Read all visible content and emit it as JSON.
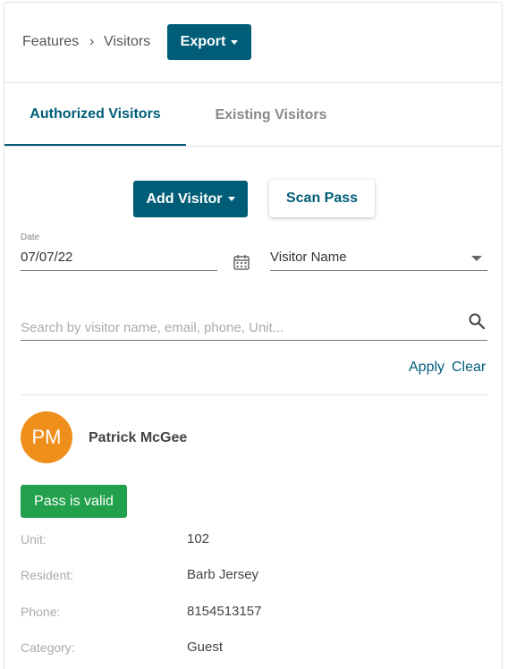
{
  "breadcrumb": {
    "features": "Features",
    "separator": "›",
    "visitors": "Visitors"
  },
  "toolbar": {
    "export_label": "Export"
  },
  "tabs": [
    {
      "label": "Authorized Visitors",
      "active": true
    },
    {
      "label": "Existing Visitors",
      "active": false
    }
  ],
  "actions": {
    "add_visitor_label": "Add Visitor",
    "scan_pass_label": "Scan Pass"
  },
  "filters": {
    "date_label": "Date",
    "date_value": "07/07/22",
    "select_value": "Visitor Name",
    "search_placeholder": "Search by visitor name, email, phone, Unit...",
    "apply_label": "Apply",
    "clear_label": "Clear"
  },
  "visitor": {
    "initials": "PM",
    "name": "Patrick McGee",
    "pass_status": "Pass is valid",
    "details": [
      {
        "label": "Unit:",
        "value": "102"
      },
      {
        "label": "Resident:",
        "value": "Barb Jersey"
      },
      {
        "label": "Phone:",
        "value": "8154513157"
      },
      {
        "label": "Category:",
        "value": "Guest"
      }
    ]
  },
  "colors": {
    "primary": "#005d78",
    "avatar": "#ef8f1b",
    "success": "#22a04b"
  }
}
